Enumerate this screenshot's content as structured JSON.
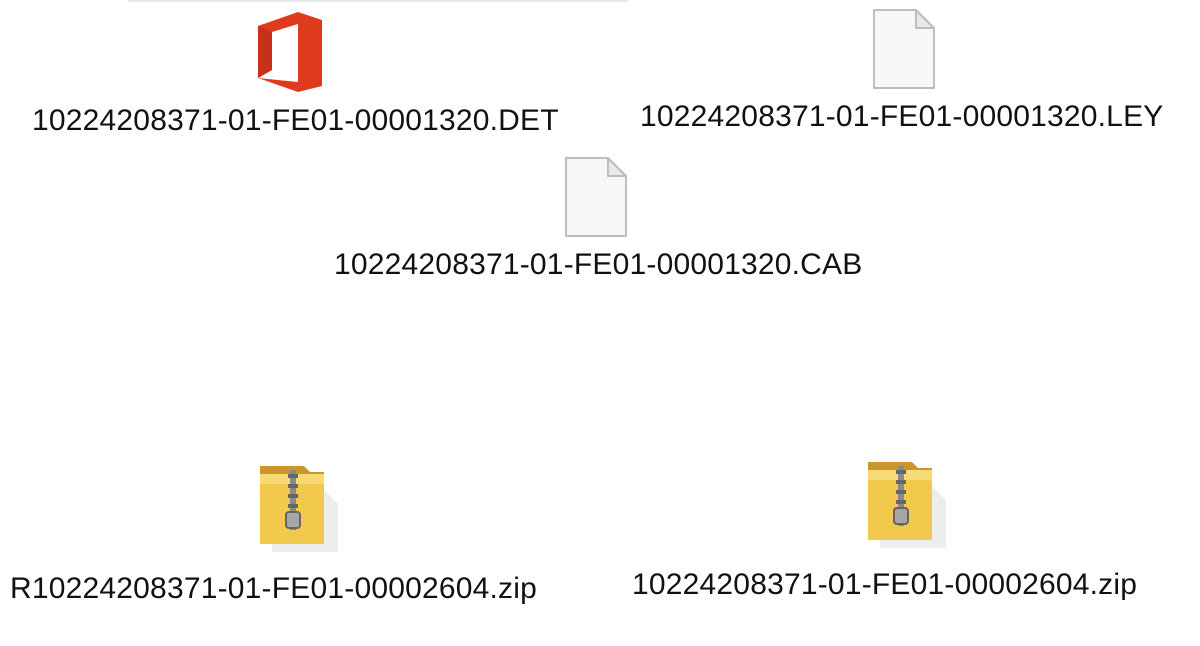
{
  "files": [
    {
      "name": "10224208371-01-FE01-00001320.DET",
      "icon": "office-icon"
    },
    {
      "name": "10224208371-01-FE01-00001320.LEY",
      "icon": "blank-file-icon"
    },
    {
      "name": "10224208371-01-FE01-00001320.CAB",
      "icon": "blank-file-icon"
    },
    {
      "name": "R10224208371-01-FE01-00002604.zip",
      "icon": "zip-folder-icon"
    },
    {
      "name": "10224208371-01-FE01-00002604.zip",
      "icon": "zip-folder-icon"
    }
  ],
  "colors": {
    "office_red": "#e03a1e",
    "folder_yellow": "#f2c94c",
    "folder_dark": "#c9972a"
  }
}
